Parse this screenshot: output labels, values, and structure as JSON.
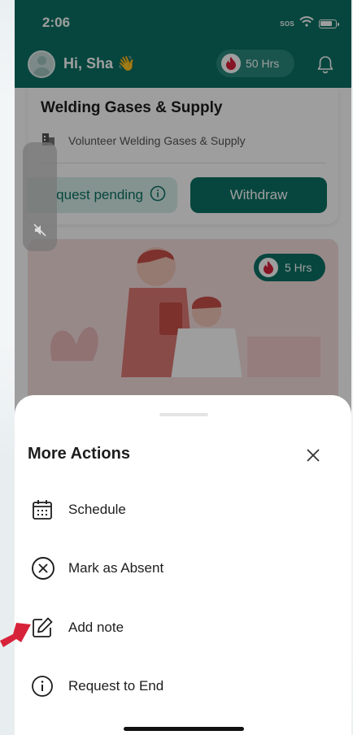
{
  "status_bar": {
    "time": "2:06",
    "sos": "SOS"
  },
  "header": {
    "greeting": "Hi, Sha 👋",
    "hours": "50 Hrs"
  },
  "card1": {
    "title": "Welding Gases & Supply",
    "org": "Volunteer Welding Gases & Supply",
    "pending_label": "quest pending",
    "withdraw_label": "Withdraw"
  },
  "card2": {
    "hours": "5 Hrs"
  },
  "sheet": {
    "title": "More Actions",
    "actions": [
      {
        "label": "Schedule",
        "icon": "calendar-icon"
      },
      {
        "label": "Mark as Absent",
        "icon": "x-circle-icon"
      },
      {
        "label": "Add note",
        "icon": "edit-note-icon"
      },
      {
        "label": "Request to End",
        "icon": "info-icon"
      }
    ]
  },
  "colors": {
    "primary": "#0b7264",
    "accent_red": "#d7233a"
  }
}
